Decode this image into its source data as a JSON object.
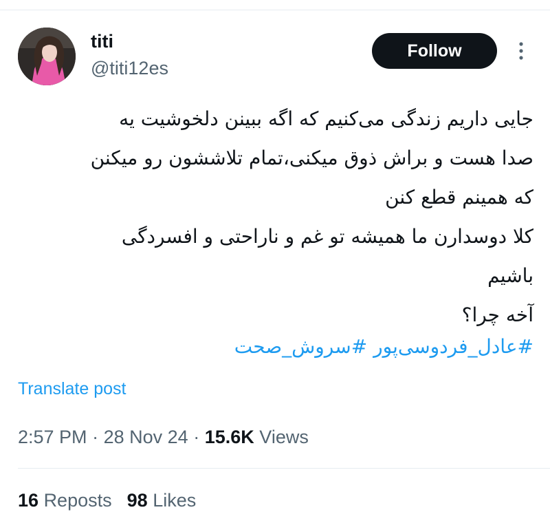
{
  "author": {
    "display_name": "titi",
    "handle": "@titi12es"
  },
  "follow_label": "Follow",
  "more_icon": "more-vertical-icon",
  "body_lines": [
    "جایی داریم زندگی می‌کنیم که اگه ببینن دلخوشیت یه",
    "صدا هست و براش ذوق میکنی،تمام تلاششون رو میکنن",
    "که همینم قطع کنن",
    "کلا دوسدارن ما همیشه تو غم و ناراحتی و افسردگی",
    "باشیم",
    "آخه چرا؟"
  ],
  "hashtags": [
    "#عادل_فردوسی‌پور",
    "#سروش_صحت"
  ],
  "translate_label": "Translate post",
  "meta": {
    "time": "2:57 PM",
    "separator": "·",
    "date": "28 Nov 24",
    "views_count": "15.6K",
    "views_label": "Views"
  },
  "stats": {
    "reposts_count": "16",
    "reposts_label": "Reposts",
    "likes_count": "98",
    "likes_label": "Likes"
  },
  "colors": {
    "accent": "#1d9bf0",
    "text": "#0f1419",
    "secondary": "#536471",
    "button": "#0f1419",
    "divider": "#e6ecf0"
  }
}
